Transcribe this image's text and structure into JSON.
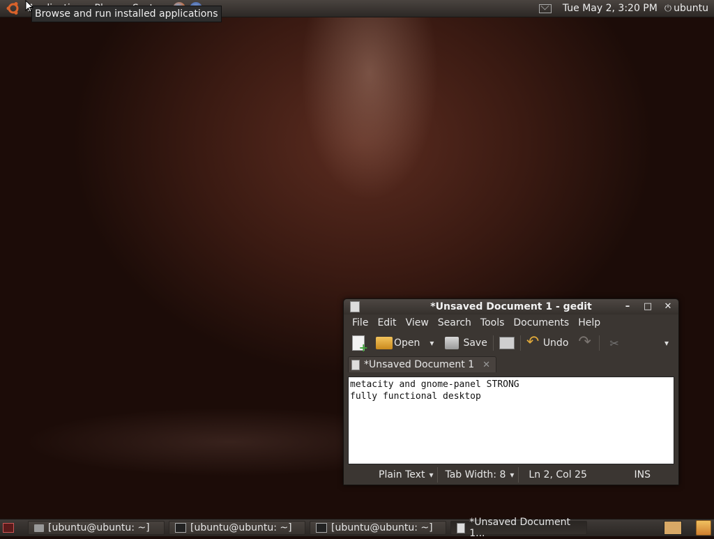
{
  "top_panel": {
    "menus": [
      "Applications",
      "Places",
      "System"
    ],
    "clock": "Tue May  2,  3:20 PM",
    "user": "ubuntu",
    "tooltip": "Browse and run installed applications"
  },
  "window": {
    "title": "*Unsaved Document 1 - gedit",
    "menu": [
      "File",
      "Edit",
      "View",
      "Search",
      "Tools",
      "Documents",
      "Help"
    ],
    "toolbar": {
      "open_label": "Open",
      "save_label": "Save",
      "undo_label": "Undo"
    },
    "tab_label": "*Unsaved Document 1",
    "content_lines": [
      "metacity and gnome-panel STRONG",
      "fully functional desktop"
    ],
    "status": {
      "language": "Plain Text",
      "tab_width": "Tab Width:  8",
      "position": "Ln 2, Col 25",
      "mode": "INS"
    }
  },
  "taskbar": {
    "tasks": [
      {
        "label": "[ubuntu@ubuntu: ~]",
        "icon": "folder-icon"
      },
      {
        "label": "[ubuntu@ubuntu: ~]",
        "icon": "terminal-icon"
      },
      {
        "label": "[ubuntu@ubuntu: ~]",
        "icon": "terminal-icon"
      },
      {
        "label": "*Unsaved Document 1...",
        "icon": "text-editor-icon"
      }
    ]
  },
  "colors": {
    "panel": "#3f3a37",
    "desktop": "#3a1a12",
    "accent_undo": "#e0a93a"
  }
}
